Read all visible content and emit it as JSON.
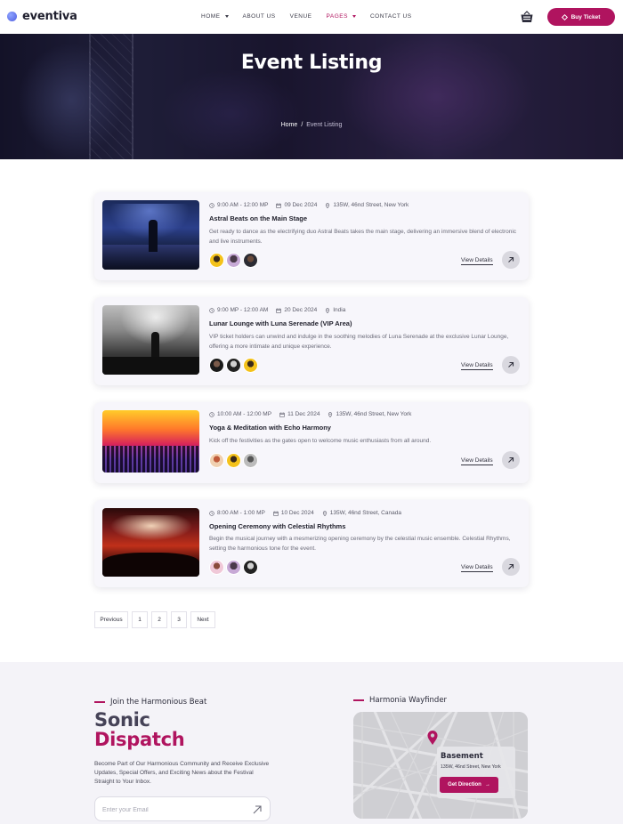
{
  "brand": {
    "name": "eventiva",
    "accent": "#b0145f"
  },
  "nav": {
    "items": [
      {
        "label": "HOME",
        "has_dropdown": true,
        "active": false
      },
      {
        "label": "ABOUT US",
        "has_dropdown": false,
        "active": false
      },
      {
        "label": "VENUE",
        "has_dropdown": false,
        "active": false
      },
      {
        "label": "PAGES",
        "has_dropdown": true,
        "active": true
      },
      {
        "label": "CONTACT US",
        "has_dropdown": false,
        "active": false
      }
    ],
    "cart_icon": "basket-icon",
    "buy_label": "Buy Ticket"
  },
  "hero": {
    "title": "Event Listing",
    "breadcrumb": {
      "home": "Home",
      "separator": "/",
      "current": "Event Listing"
    }
  },
  "events": [
    {
      "time": "9:00 AM - 12:00 MP",
      "date": "09 Dec 2024",
      "location": "135W, 46nd Street, New York",
      "title": "Astral Beats on the Main Stage",
      "description": "Get ready to dance as the electrifying duo Astral Beats takes the main stage, delivering an immersive blend of electronic and live instruments.",
      "cta": "View Details"
    },
    {
      "time": "9:00 MP - 12:00 AM",
      "date": "20 Dec 2024",
      "location": "India",
      "title": "Lunar Lounge with Luna Serenade (VIP Area)",
      "description": "VIP ticket holders can unwind and indulge in the soothing melodies of Luna Serenade at the exclusive Lunar Lounge, offering a more intimate and unique experience.",
      "cta": "View Details"
    },
    {
      "time": "10:00 AM - 12:00 MP",
      "date": "11 Dec 2024",
      "location": "135W, 46nd Street, New York",
      "title": "Yoga & Meditation with Echo Harmony",
      "description": "Kick off the festivities as the gates open to welcome music enthusiasts from all around.",
      "cta": "View Details"
    },
    {
      "time": "8:00 AM - 1:00 MP",
      "date": "10 Dec 2024",
      "location": "135W, 46nd Street, Canada",
      "title": "Opening Ceremony with Celestial Rhythms",
      "description": "Begin the musical journey with a mesmerizing opening ceremony by the celestial music ensemble. Celestial Rhythms, setting the harmonious tone for the event.",
      "cta": "View Details"
    }
  ],
  "pagination": {
    "previous": "Previous",
    "pages": [
      "1",
      "2",
      "3"
    ],
    "next": "Next"
  },
  "newsletter": {
    "eyebrow": "Join the Harmonious Beat",
    "title_line1": "Sonic",
    "title_line2": "Dispatch",
    "description": "Become Part of Our Harmonious Community and Receive Exclusive Updates, Special Offers, and Exciting News about the Festival Straight to Your Inbox.",
    "email_placeholder": "Enter your Email"
  },
  "wayfinder": {
    "eyebrow": "Harmonia Wayfinder",
    "place": "Basement",
    "address": "135W, 46nd Street, New York",
    "button": "Get Direction"
  }
}
